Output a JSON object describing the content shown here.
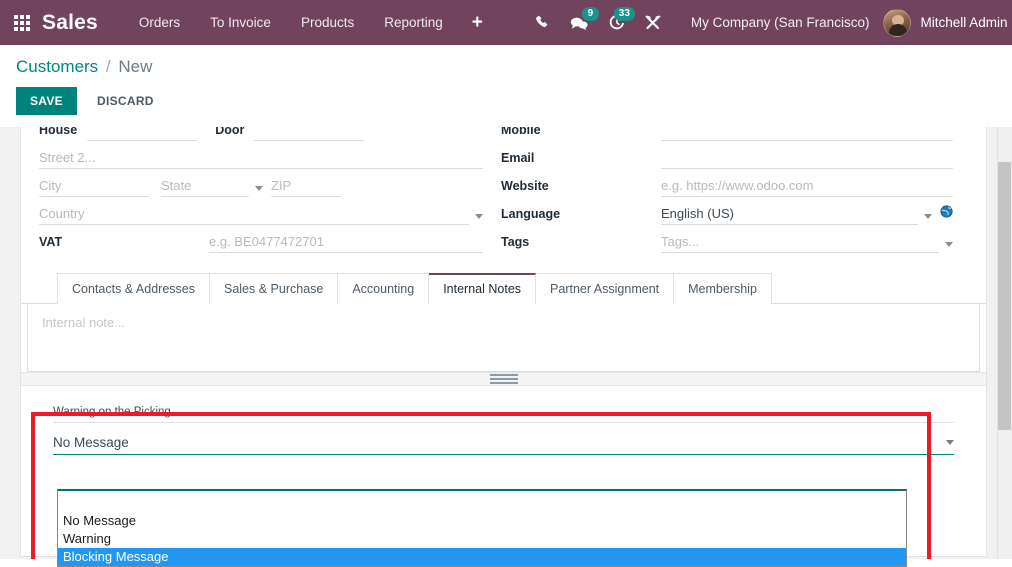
{
  "navbar": {
    "apps_icon": "apps-grid-icon",
    "brand": "Sales",
    "menus": [
      {
        "label": "Orders"
      },
      {
        "label": "To Invoice"
      },
      {
        "label": "Products"
      },
      {
        "label": "Reporting"
      }
    ],
    "plus_label": "+",
    "systray": {
      "phone_icon": "phone-icon",
      "messages_icon": "chat-bubble-icon",
      "messages_count": "9",
      "activities_icon": "clock-activity-icon",
      "activities_count": "33",
      "tools_icon": "wrench-tools-icon"
    },
    "company": "My Company (San Francisco)",
    "user": "Mitchell Admin",
    "colors": {
      "background": "#71435c",
      "badge": "#17948d"
    }
  },
  "control_panel": {
    "breadcrumb_root": "Customers",
    "breadcrumb_separator": "/",
    "breadcrumb_current": "New",
    "save_label": "SAVE",
    "discard_label": "DISCARD",
    "save_color": "#00827c"
  },
  "form": {
    "left": {
      "house_label": "House",
      "house_value": "",
      "door_label": "Door",
      "door_value": "",
      "street2_placeholder": "Street 2...",
      "city_placeholder": "City",
      "state_placeholder": "State",
      "zip_placeholder": "ZIP",
      "country_placeholder": "Country",
      "vat_label": "VAT",
      "vat_placeholder": "e.g. BE0477472701"
    },
    "right": {
      "mobile_label": "Mobile",
      "mobile_value": "",
      "email_label": "Email",
      "email_value": "",
      "website_label": "Website",
      "website_placeholder": "e.g. https://www.odoo.com",
      "language_label": "Language",
      "language_value": "English (US)",
      "tags_label": "Tags",
      "tags_placeholder": "Tags..."
    }
  },
  "notebook": {
    "tabs": [
      {
        "label": "Contacts & Addresses",
        "active": false
      },
      {
        "label": "Sales & Purchase",
        "active": false
      },
      {
        "label": "Accounting",
        "active": false
      },
      {
        "label": "Internal Notes",
        "active": true
      },
      {
        "label": "Partner Assignment",
        "active": false
      },
      {
        "label": "Membership",
        "active": false
      }
    ],
    "active_tab_color": "#71435c",
    "internal_note_placeholder": "Internal note..."
  },
  "picking_warning": {
    "field_label": "Warning on the Picking",
    "selected_value": "No Message",
    "options": [
      {
        "label": "",
        "selected": false
      },
      {
        "label": "No Message",
        "selected": false
      },
      {
        "label": "Warning",
        "selected": false
      },
      {
        "label": "Blocking Message",
        "selected": true
      }
    ],
    "highlight_color": "#2196f3"
  },
  "annotation": {
    "red_box_color": "#ed1c24"
  }
}
